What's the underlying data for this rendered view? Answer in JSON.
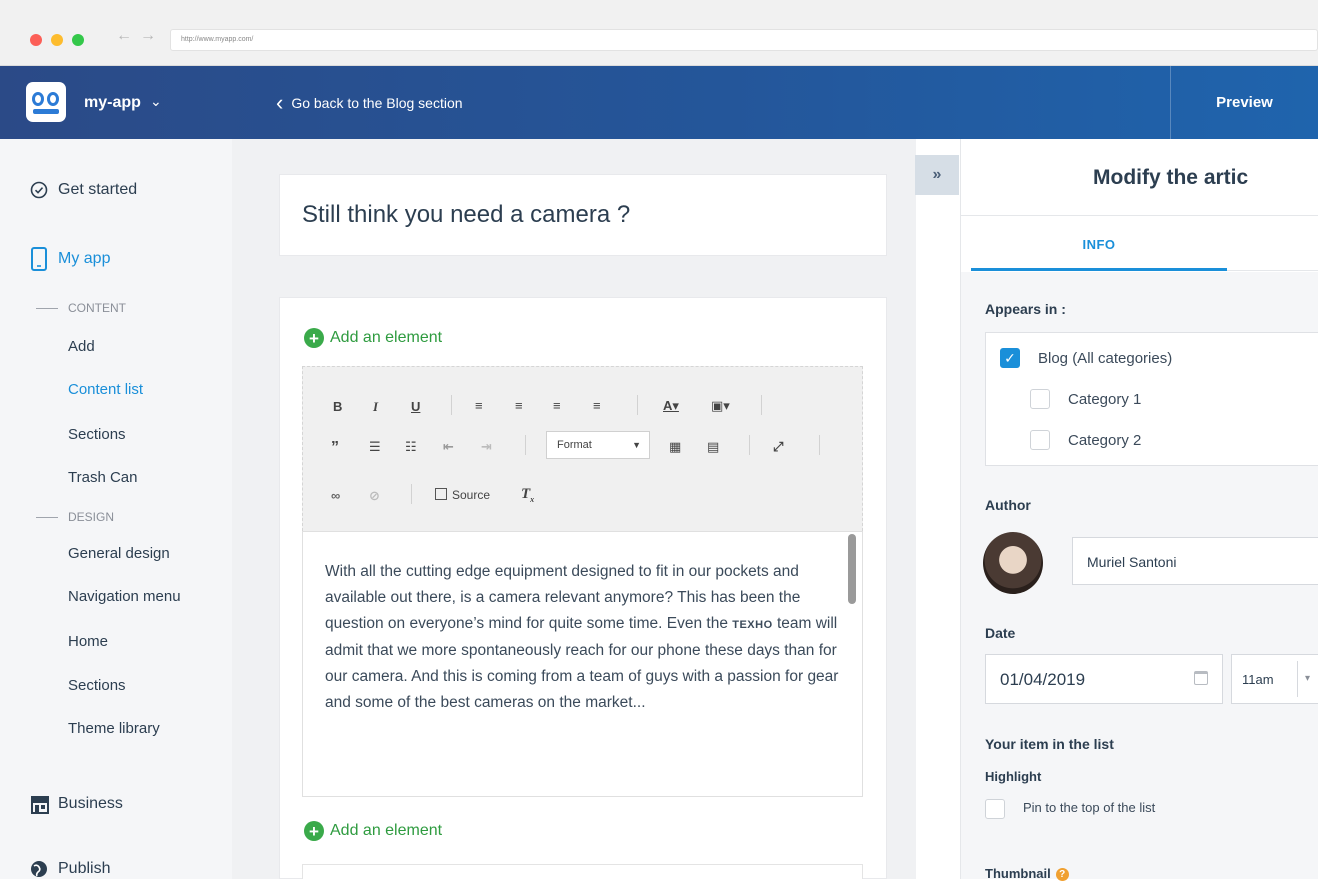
{
  "browser": {
    "url": "http://www.myapp.com/"
  },
  "header": {
    "app_name": "my-app",
    "back_label": "Go back to the Blog section",
    "preview_label": "Preview"
  },
  "sidebar": {
    "get_started": "Get started",
    "my_app": "My app",
    "content_heading": "CONTENT",
    "content_items": [
      "Add",
      "Content list",
      "Sections",
      "Trash Can"
    ],
    "design_heading": "DESIGN",
    "design_items": [
      "General design",
      "Navigation menu",
      "Home",
      "Sections",
      "Theme library"
    ],
    "business": "Business",
    "publish": "Publish"
  },
  "editor": {
    "title": "Still think you need a camera ?",
    "add_element_label": "Add an element",
    "toolbar": {
      "bold": "B",
      "italic": "I",
      "underline": "U",
      "format_label": "Format",
      "source_label": "Source"
    },
    "body_before_brand": "With all the cutting edge equipment designed to fit in our pockets and available out there, is a camera relevant anymore? This has been the question on everyone’s mind for quite some time. Even the ",
    "brand": "TEXHO",
    "body_after_brand": " team will admit that we more spontaneously reach for our phone these days than for our camera. And this is coming from a team of guys with a passion for gear and some of the best cameras on the market..."
  },
  "panel": {
    "title": "Modify the artic",
    "tab_info": "INFO",
    "appears_in_label": "Appears in :",
    "categories": [
      {
        "label": "Blog (All categories)",
        "checked": true
      },
      {
        "label": "Category 1",
        "checked": false
      },
      {
        "label": "Category 2",
        "checked": false
      }
    ],
    "author_label": "Author",
    "author_value": "Muriel Santoni",
    "date_label": "Date",
    "date_value": "01/04/2019",
    "time_value": "11am",
    "list_section_label": "Your item in the list",
    "highlight_label": "Highlight",
    "pin_label": "Pin to the top of the list",
    "thumbnail_label": "Thumbnail"
  },
  "colors": {
    "header_start": "#2b4a87",
    "header_end": "#1f64ad",
    "accent": "#1a8fd9",
    "add_green": "#3aaa4a"
  }
}
